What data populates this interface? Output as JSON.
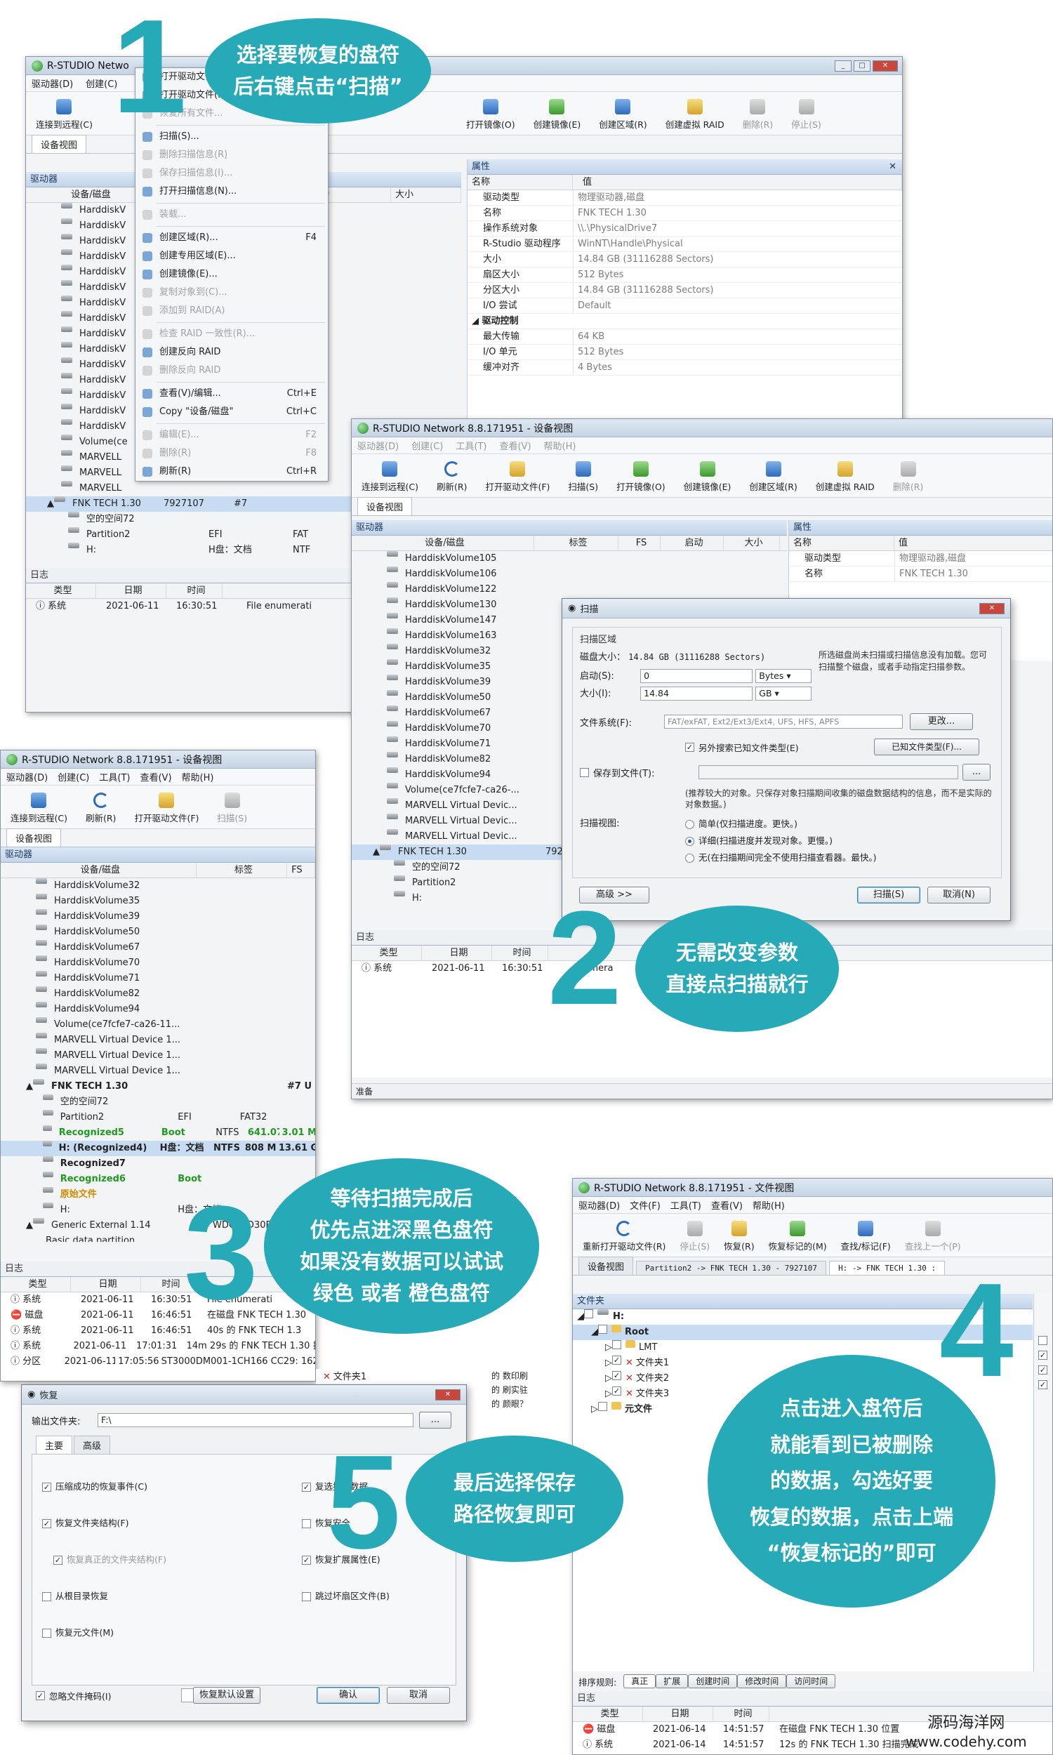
{
  "accent_color": "#27aab7",
  "app_title": "R-STUDIO Network 8.8.171951 - 设备视图",
  "app_title_short": "R-STUDIO Netwo",
  "file_view_title": "R-STUDIO Network 8.8.171951 - 文件视图",
  "menu": {
    "drive": "驱动器(D)",
    "create": "创建(C)",
    "tools": "工具(T)",
    "view": "查看(V)",
    "help": "帮助(H)",
    "file": "文件(F)"
  },
  "toolbar": {
    "connect_remote": "连接到远程(C)",
    "refresh": "刷新(R)",
    "open_drive_files": "打开驱动文件(F)",
    "scan": "扫描(S)",
    "open_image": "打开镜像(O)",
    "create_image": "创建镜像(E)",
    "create_region": "创建区域(R)",
    "create_raid": "创建虚拟 RAID",
    "delete": "删除(R)",
    "stop": "停止(S)",
    "reopen_drive_files": "重新打开驱动文件(R)",
    "recover": "恢复(R)",
    "recover_marked": "恢复标记的(M)",
    "find_mark": "查找/标记(F)",
    "find_prev": "查找上一个(P)"
  },
  "tabs": {
    "device_view": "设备视图",
    "partition_tab": "Partition2 -> FNK TECH 1.30 - 7927107",
    "h_tab": "H: -> FNK TECH 1.30 :"
  },
  "panes": {
    "drives": "驱动器",
    "properties": "属性",
    "log": "日志",
    "folders": "文件夹"
  },
  "columns": {
    "device_disk": "设备/磁盘",
    "label": "标签",
    "fs": "FS",
    "start": "启动",
    "size": "大小",
    "name": "名称",
    "value": "值",
    "type": "类型",
    "date": "日期",
    "time": "时间",
    "text": "文本"
  },
  "status_ready": "准备",
  "context_menu": [
    {
      "label": "打开驱动文件(F)",
      "shortcut": "",
      "disabled": false
    },
    {
      "label": "打开驱动文件(F)",
      "shortcut": "",
      "disabled": false
    },
    {
      "label": "恢复所有文件...",
      "shortcut": "",
      "disabled": true
    },
    {
      "sep": true
    },
    {
      "label": "扫描(S)...",
      "shortcut": "",
      "disabled": false
    },
    {
      "label": "删除扫描信息(R)",
      "shortcut": "",
      "disabled": true
    },
    {
      "label": "保存扫描信息(I)...",
      "shortcut": "",
      "disabled": true
    },
    {
      "label": "打开扫描信息(N)...",
      "shortcut": "",
      "disabled": false
    },
    {
      "sep": true
    },
    {
      "label": "装载...",
      "shortcut": "",
      "disabled": true
    },
    {
      "sep": true
    },
    {
      "label": "创建区域(R)...",
      "shortcut": "F4",
      "disabled": false
    },
    {
      "label": "创建专用区域(E)...",
      "shortcut": "",
      "disabled": false
    },
    {
      "label": "创建镜像(E)...",
      "shortcut": "",
      "disabled": false
    },
    {
      "label": "复制对象到(C)...",
      "shortcut": "",
      "disabled": true
    },
    {
      "label": "添加到 RAID(A)",
      "shortcut": "",
      "disabled": true
    },
    {
      "sep": true
    },
    {
      "label": "检查 RAID 一致性(R)...",
      "shortcut": "",
      "disabled": true
    },
    {
      "label": "创建反向 RAID",
      "shortcut": "",
      "disabled": false
    },
    {
      "label": "删除反向 RAID",
      "shortcut": "",
      "disabled": true
    },
    {
      "sep": true
    },
    {
      "label": "查看(V)/编辑...",
      "shortcut": "Ctrl+E",
      "disabled": false
    },
    {
      "label": "Copy \"设备/磁盘\"",
      "shortcut": "Ctrl+C",
      "disabled": false
    },
    {
      "sep": true
    },
    {
      "label": "编辑(E)...",
      "shortcut": "F2",
      "disabled": true
    },
    {
      "label": "删除(R)",
      "shortcut": "F8",
      "disabled": true
    },
    {
      "label": "刷新(R)",
      "shortcut": "Ctrl+R",
      "disabled": false
    }
  ],
  "win1_drives": [
    "HarddiskV",
    "HarddiskV",
    "HarddiskV",
    "HarddiskV",
    "HarddiskV",
    "HarddiskV",
    "HarddiskV",
    "HarddiskV",
    "HarddiskV",
    "HarddiskV",
    "HarddiskV",
    "HarddiskV",
    "HarddiskV",
    "HarddiskV",
    "HarddiskV",
    "Volume(ce",
    "MARVELL",
    "MARVELL",
    "MARVELL"
  ],
  "win1_fnk": {
    "name": "FNK TECH 1.30",
    "size": "7927107",
    "fs": "#7"
  },
  "win1_sub": [
    {
      "name": "空的空间72",
      "label": "",
      "fs": ""
    },
    {
      "name": "Partition2",
      "label": "EFI",
      "fs": "FAT"
    },
    {
      "name": "H:",
      "label": "H盘：文档",
      "fs": "NTF"
    }
  ],
  "properties": [
    {
      "k": "驱动类型",
      "v": "物理驱动器,磁盘"
    },
    {
      "k": "名称",
      "v": "FNK TECH 1.30"
    },
    {
      "k": "操作系统对象",
      "v": "\\\\.\\PhysicalDrive7"
    },
    {
      "k": "R-Studio 驱动程序",
      "v": "WinNT\\Handle\\Physical"
    },
    {
      "k": "大小",
      "v": "14.84 GB (31116288 Sectors)"
    },
    {
      "k": "扇区大小",
      "v": "512 Bytes"
    },
    {
      "k": "分区大小",
      "v": "14.84 GB (31116288 Sectors)"
    },
    {
      "k": "I/O 尝试",
      "v": "Default"
    }
  ],
  "drive_control": "驱动控制",
  "drive_control_props": [
    {
      "k": "最大传输",
      "v": "64 KB"
    },
    {
      "k": "I/O 单元",
      "v": "512 Bytes"
    },
    {
      "k": "缓冲对齐",
      "v": "4 Bytes"
    }
  ],
  "log1": {
    "type": "系统",
    "date": "2021-06-11",
    "time": "16:30:51",
    "text": "File enumerati"
  },
  "win2_drives": [
    "HarddiskVolume105",
    "HarddiskVolume106",
    "HarddiskVolume122",
    "HarddiskVolume130",
    "HarddiskVolume147",
    "HarddiskVolume163",
    "HarddiskVolume32",
    "HarddiskVolume35",
    "HarddiskVolume39",
    "HarddiskVolume50",
    "HarddiskVolume67",
    "HarddiskVolume70",
    "HarddiskVolume71",
    "HarddiskVolume82",
    "HarddiskVolume94",
    "Volume(ce7fcfe7-ca26-...",
    "MARVELL Virtual Devic...",
    "MARVELL Virtual Devic...",
    "MARVELL Virtual Devic..."
  ],
  "win2_fnk": "FNK TECH 1.30",
  "win2_fnk_size": "7927",
  "win2_sub": [
    {
      "name": "空的空间72",
      "label": ""
    },
    {
      "name": "Partition2",
      "label": "EFI"
    },
    {
      "name": "H:",
      "label": "H盘"
    }
  ],
  "win2_props": [
    {
      "k": "驱动类型",
      "v": "物理驱动器,磁盘"
    },
    {
      "k": "名称",
      "v": "FNK TECH 1.30"
    }
  ],
  "win2_log": {
    "type": "系统",
    "date": "2021-06-11",
    "time": "16:30:51",
    "text": "enumera"
  },
  "scan_dialog": {
    "title": "扫描",
    "section": "扫描区域",
    "disk_size_label": "磁盘大小：",
    "disk_size": "14.84 GB (31116288 Sectors)",
    "note": "所选磁盘尚未扫描或扫描信息没有加载。您可扫描整个磁盘，或者手动指定扫描参数。",
    "start_label": "启动(S):",
    "start_value": "0",
    "start_unit": "Bytes",
    "size_label": "大小(I):",
    "size_value": "14.84",
    "size_unit": "GB",
    "fs_label": "文件系统(F):",
    "fs_value": "FAT/exFAT, Ext2/Ext3/Ext4, UFS, HFS, APFS",
    "change": "更改...",
    "extra_search": "另外搜索已知文件类型(E)",
    "known_types": "已知文件类型(F)...",
    "save_to_file": "保存到文件(T):",
    "browse": "...",
    "save_note": "(推荐较大的对象。只保存对象扫描期间收集的磁盘数据结构的信息，而不是实际的对象数据。)",
    "scan_view": "扫描视图:",
    "opt_simple": "简单(仅扫描进度。更快。)",
    "opt_detail": "详细(扫描进度并发现对象。更慢。)",
    "opt_none": "无(在扫描期间完全不使用扫描查看器。最快。)",
    "advanced": "高级 >>",
    "scan_btn": "扫描(S)",
    "cancel_btn": "取消(N)"
  },
  "win3_drives": [
    "HarddiskVolume32",
    "HarddiskVolume35",
    "HarddiskVolume39",
    "HarddiskVolume50",
    "HarddiskVolume67",
    "HarddiskVolume70",
    "HarddiskVolume71",
    "HarddiskVolume82",
    "HarddiskVolume94",
    "Volume(ce7fcfe7-ca26-11...",
    "MARVELL Virtual Device 1...",
    "MARVELL Virtual Device 1...",
    "MARVELL Virtual Device 1..."
  ],
  "win3_fnk": {
    "name": "FNK TECH 1.30",
    "fs": "#7 U"
  },
  "win3_sub": [
    {
      "name": "空的空间72",
      "label": "",
      "fs": "",
      "start": "",
      "size": "",
      "cls": ""
    },
    {
      "name": "Partition2",
      "label": "EFI",
      "fs": "FAT32",
      "start": "",
      "size": "",
      "cls": ""
    },
    {
      "name": "Recognized5",
      "label": "Boot",
      "fs": "NTFS",
      "start": "641.07 ...",
      "size": "3.01 MB",
      "cls": "green"
    },
    {
      "name": "H: (Recognized4)",
      "label": "H盘：文档",
      "fs": "NTFS",
      "start": "808 MB",
      "size": "13.61 GB",
      "cls": "sel"
    },
    {
      "name": "Recognized7",
      "label": "",
      "fs": "",
      "start": "",
      "size": "",
      "cls": "bold"
    },
    {
      "name": "Recognized6",
      "label": "Boot",
      "fs": "",
      "start": "",
      "size": "",
      "cls": "green"
    },
    {
      "name": "原始文件",
      "label": "",
      "fs": "",
      "start": "",
      "size": "",
      "cls": "orange"
    },
    {
      "name": "H:",
      "label": "H盘：文档",
      "fs": "",
      "start": "",
      "size": "",
      "cls": ""
    }
  ],
  "win3_generic": {
    "name": "Generic External 1.14",
    "label": "WDC WD30EZRX-1A5"
  },
  "win3_basic": "Basic data partition",
  "win3_log": [
    {
      "type": "系统",
      "date": "2021-06-11",
      "time": "16:30:51",
      "text": "File enumerati",
      "err": false
    },
    {
      "type": "磁盘",
      "date": "2021-06-11",
      "time": "16:46:51",
      "text": "在磁盘 FNK TECH 1.30",
      "err": true
    },
    {
      "type": "系统",
      "date": "2021-06-11",
      "time": "16:46:51",
      "text": "40s 的 FNK TECH 1.3",
      "err": false
    },
    {
      "type": "系统",
      "date": "2021-06-11",
      "time": "17:01:31",
      "text": "14m 29s 的 FNK TECH 1.30 扫描",
      "err": false
    },
    {
      "type": "分区",
      "date": "2021-06-11",
      "time": "17:05:56",
      "text": "ST3000DM001-1CH166 CC29: 16227264300",
      "err": false
    }
  ],
  "file_tree": {
    "h": "H:",
    "root": "Root",
    "children": [
      {
        "name": "LMT",
        "checked": false,
        "deleted": false
      },
      {
        "name": "文件夹1",
        "checked": true,
        "deleted": true
      },
      {
        "name": "文件夹2",
        "checked": true,
        "deleted": true
      },
      {
        "name": "文件夹3",
        "checked": true,
        "deleted": true
      }
    ],
    "meta": "元文件"
  },
  "sort_bar": {
    "label": "排序规则:",
    "items": [
      "真正",
      "扩展",
      "创建时间",
      "修改时间",
      "访问时间"
    ]
  },
  "file_log": [
    {
      "type": "磁盘",
      "date": "2021-06-14",
      "time": "14:51:57",
      "text": "在磁盘 FNK TECH 1.30 位置",
      "err": true
    },
    {
      "type": "系统",
      "date": "2021-06-14",
      "time": "14:51:57",
      "text": "12s 的 FNK TECH 1.30 扫描完成",
      "err": false
    }
  ],
  "recover_dialog": {
    "title": "恢复",
    "output_label": "输出文件夹:",
    "output_value": "F:\\",
    "browse": "...",
    "tab_main": "主要",
    "tab_adv": "高级",
    "left_opts": [
      {
        "label": "压缩成功的恢复事件(C)",
        "checked": true,
        "disabled": false
      },
      {
        "label": "恢复文件夹结构(F)",
        "checked": true,
        "disabled": false
      },
      {
        "label": "恢复真正的文件夹结构(F)",
        "checked": true,
        "disabled": true
      },
      {
        "label": "从根目录恢复",
        "checked": false,
        "disabled": false
      },
      {
        "label": "恢复元文件(M)",
        "checked": false,
        "disabled": false
      }
    ],
    "right_opts": [
      {
        "label": "复选择的数据",
        "checked": true
      },
      {
        "label": "恢复安全",
        "checked": false
      },
      {
        "label": "恢复扩展属性(E)",
        "checked": true
      },
      {
        "label": "跳过坏扇区文件(B)",
        "checked": false
      }
    ],
    "ignore_mask": "忽略文件掩码(I)",
    "defaults": "恢复默认设置",
    "ok": "确认",
    "cancel": "取消"
  },
  "behind_folder": "文件夹1",
  "behind_texts": [
    "的 数印刷",
    "的 刷实驻",
    "的 颜眼？"
  ],
  "callouts": {
    "n1": "1",
    "t1a": "选择要恢复的盘符",
    "t1b": "后右键点击“扫描”",
    "n2": "2",
    "t2a": "无需改变参数",
    "t2b": "直接点扫描就行",
    "n3": "3",
    "t3a": "等待扫描完成后",
    "t3b": "优先点进深黑色盘符",
    "t3c": "如果没有数据可以试试",
    "t3d": "绿色 或者 橙色盘符",
    "n4": "4",
    "t4a": "点击进入盘符后",
    "t4b": "就能看到已被删除",
    "t4c": "的数据，勾选好要",
    "t4d": "恢复的数据，点击上端",
    "t4e": "“恢复标记的”即可",
    "n5": "5",
    "t5a": "最后选择保存",
    "t5b": "路径恢复即可"
  },
  "watermark": {
    "line1": "源码海洋网",
    "line2": "www.codehy.com"
  }
}
